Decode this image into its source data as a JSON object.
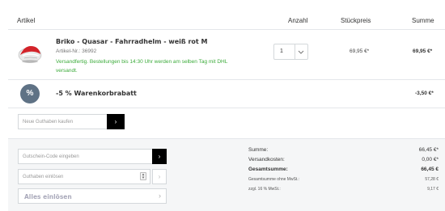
{
  "header": {
    "article": "Artikel",
    "quantity": "Anzahl",
    "unit_price": "Stückpreis",
    "total": "Summe"
  },
  "product": {
    "name": "Briko - Quasar - Fahrradhelm - weiß rot M",
    "article_number": "Artikel-Nr.: 36992",
    "shipping": "Versandfertig. Bestellungen bis 14:30 Uhr werden am selben Tag mit DHL versandt.",
    "quantity": "1",
    "unit_price": "69,95 €*",
    "sum": "69,95 €*",
    "image_icon": "helmet-image"
  },
  "discount": {
    "symbol": "%",
    "name": "-5 % Warenkorbrabatt",
    "value": "-3,50 €*"
  },
  "gift": {
    "placeholder": "Neue Guthaben kaufen",
    "button": "›"
  },
  "voucher": {
    "placeholder": "Gutschein-Code eingeben",
    "button": "›"
  },
  "credit": {
    "placeholder": "Guthaben einlösen",
    "button": "›",
    "redeem_all": "Alles einlösen",
    "redeem_all_chevron": "›"
  },
  "summary": {
    "sum_label": "Summe:",
    "sum_value": "66,45 €*",
    "shipping_label": "Versandkosten:",
    "shipping_value": "0,00 €*",
    "total_label": "Gesamtsumme:",
    "total_value": "66,45 €",
    "net_label": "Gesamtsumme ohne MwSt.:",
    "net_value": "57,28 €",
    "vat_label": "zzgl. 16 % MwSt.:",
    "vat_value": "9,17 €"
  },
  "colors": {
    "shipping_green": "#3cab3b",
    "discount_badge": "#5f7285",
    "button_black": "#000000"
  }
}
